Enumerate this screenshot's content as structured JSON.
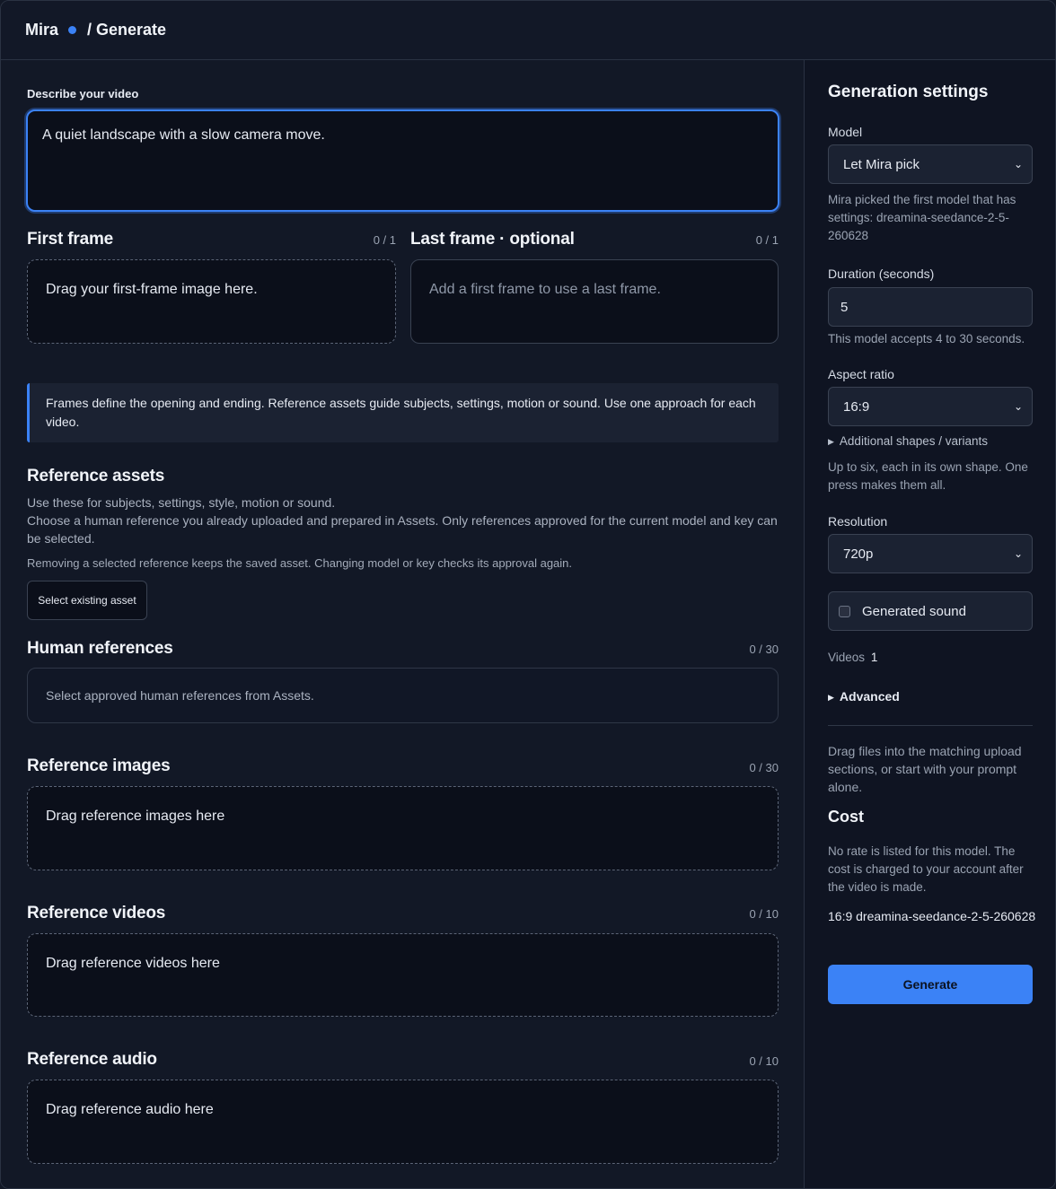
{
  "header": {
    "brand": "Mira",
    "crumb": "/ Generate"
  },
  "prompt": {
    "label": "Describe your video",
    "value": "A quiet landscape with a slow camera move."
  },
  "first_frame": {
    "title": "First frame",
    "count": "0 / 1",
    "drop_text": "Drag your first-frame image here."
  },
  "last_frame": {
    "title": "Last frame · optional",
    "count": "0 / 1",
    "placeholder": "Add a first frame to use a last frame."
  },
  "info_text": "Frames define the opening and ending. Reference assets guide subjects, settings, motion or sound. Use one approach for each video.",
  "reference_assets": {
    "title": "Reference assets",
    "line1": "Use these for subjects, settings, style, motion or sound.",
    "line2": "Choose a human reference you already uploaded and prepared in Assets. Only references approved for the current model and key can be selected.",
    "line3": "Removing a selected reference keeps the saved asset. Changing model or key checks its approval again.",
    "button": "Select existing asset"
  },
  "human_references": {
    "title": "Human references",
    "count": "0 / 30",
    "placeholder": "Select approved human references from Assets."
  },
  "reference_images": {
    "title": "Reference images",
    "count": "0 / 30",
    "drop_text": "Drag reference images here"
  },
  "reference_videos": {
    "title": "Reference videos",
    "count": "0 / 10",
    "drop_text": "Drag reference videos here"
  },
  "reference_audio": {
    "title": "Reference audio",
    "count": "0 / 10",
    "drop_text": "Drag reference audio here"
  },
  "settings": {
    "title": "Generation settings",
    "model_label": "Model",
    "model_value": "Let Mira pick",
    "model_note": "Mira picked the first model that has settings: dreamina-seedance-2-5-260628",
    "duration_label": "Duration (seconds)",
    "duration_value": "5",
    "duration_note": "This model accepts 4 to 30 seconds.",
    "aspect_label": "Aspect ratio",
    "aspect_value": "16:9",
    "shapes_label": "Additional shapes / variants",
    "shapes_note": "Up to six, each in its own shape. One press makes them all.",
    "resolution_label": "Resolution",
    "resolution_value": "720p",
    "sound_label": "Generated sound",
    "videos_label": "Videos",
    "videos_value": "1",
    "advanced_label": "Advanced",
    "drag_note": "Drag files into the matching upload sections, or start with your prompt alone.",
    "cost_title": "Cost",
    "cost_note": "No rate is listed for this model. The cost is charged to your account after the video is made.",
    "summary": "16:9 dreamina-seedance-2-5-260628",
    "generate_label": "Generate"
  },
  "colors": {
    "accent": "#3b82f6",
    "background": "#121826",
    "panel": "#0b0f1a"
  }
}
